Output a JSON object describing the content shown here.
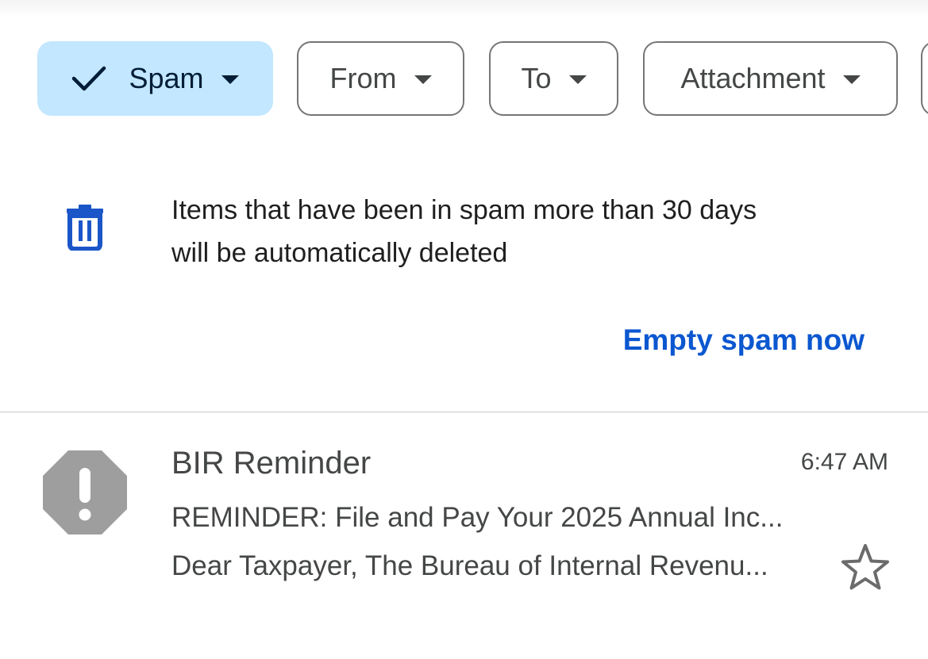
{
  "filters": {
    "spam_label": "Spam",
    "from_label": "From",
    "to_label": "To",
    "attachment_label": "Attachment"
  },
  "banner": {
    "line1": "Items that have been in spam more than 30 days",
    "line2": "will be automatically deleted",
    "action_label": "Empty spam now"
  },
  "messages": [
    {
      "sender": "BIR Reminder",
      "time": "6:47 AM",
      "subject": "REMINDER: File and Pay Your 2025 Annual Inc...",
      "snippet": "Dear Taxpayer, The Bureau of Internal Revenu...",
      "avatar_icon": "spam-warning-icon",
      "starred": false
    }
  ],
  "colors": {
    "selected_chip_bg": "#c2e7ff",
    "link_blue": "#0b57d0",
    "trash_blue": "#1a56c8",
    "spam_avatar_gray": "#9e9e9e"
  },
  "icons": [
    "check-icon",
    "caret-down-icon",
    "trash-icon",
    "spam-warning-icon",
    "star-icon"
  ]
}
